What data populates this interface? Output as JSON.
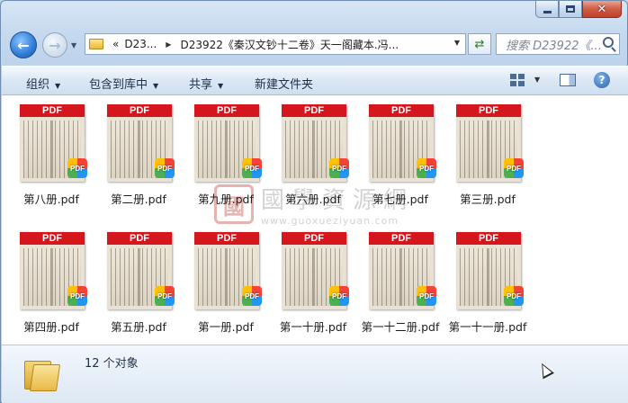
{
  "window": {
    "controls": {
      "minimize": "minimize",
      "maximize": "maximize",
      "close": "✕"
    }
  },
  "nav": {
    "address": {
      "overflow": "«",
      "segments": [
        "D23...",
        "D23922《秦汉文钞十二卷》天一阁藏本.冯..."
      ]
    },
    "search_placeholder": "搜索 D23922《..."
  },
  "toolbar": {
    "organize": "组织",
    "include_in_library": "包含到库中",
    "share": "共享",
    "new_folder": "新建文件夹"
  },
  "thumb_badge": "PDF",
  "badge_small": "PDF",
  "files": [
    "第八册.pdf",
    "第二册.pdf",
    "第九册.pdf",
    "第六册.pdf",
    "第七册.pdf",
    "第三册.pdf",
    "第四册.pdf",
    "第五册.pdf",
    "第一册.pdf",
    "第一十册.pdf",
    "第一十二册.pdf",
    "第一十一册.pdf"
  ],
  "watermark": {
    "seal": "國",
    "title": "國學資源網",
    "url": "www.guoxueziyuan.com"
  },
  "status": {
    "count_text": "12 个对象"
  },
  "colors": {
    "accent": "#d5161d",
    "window": "#c4d8ee"
  }
}
